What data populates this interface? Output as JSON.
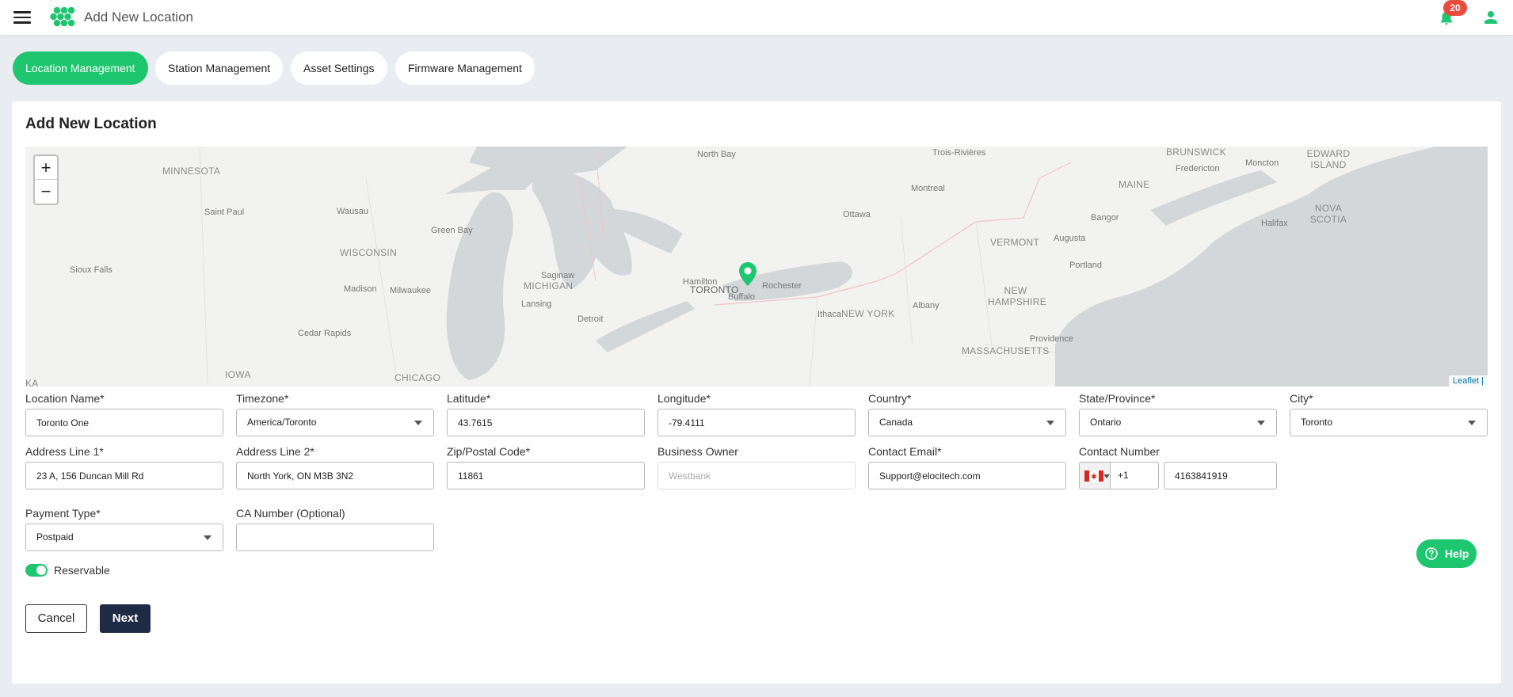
{
  "header": {
    "title": "Add New Location",
    "notification_count": "20"
  },
  "tabs": [
    {
      "label": "Location Management",
      "active": true
    },
    {
      "label": "Station Management",
      "active": false
    },
    {
      "label": "Asset Settings",
      "active": false
    },
    {
      "label": "Firmware Management",
      "active": false
    }
  ],
  "panel": {
    "title": "Add New Location"
  },
  "map": {
    "zoom_in": "+",
    "zoom_out": "−",
    "attribution": "Leaflet |",
    "labels": {
      "minnesota": "MINNESOTA",
      "wisconsin": "WISCONSIN",
      "michigan": "MICHIGAN",
      "iowa": "IOWA",
      "chicago": "CHICAGO",
      "toronto": "TORONTO",
      "new_york": "NEW YORK",
      "vermont": "VERMONT",
      "new_hampshire": "NEW HAMPSHIRE",
      "massachusetts": "MASSACHUSETTS",
      "maine": "MAINE",
      "brunswick": "BRUNSWICK",
      "edward_island": "EDWARD ISLAND",
      "nova_scotia": "NOVA SCOTIA",
      "ka": "KA",
      "saint_paul": "Saint Paul",
      "sioux_falls": "Sioux Falls",
      "madison": "Madison",
      "milwaukee": "Milwaukee",
      "cedar_rapids": "Cedar Rapids",
      "wausau": "Wausau",
      "green_bay": "Green Bay",
      "saginaw": "Saginaw",
      "lansing": "Lansing",
      "detroit": "Detroit",
      "hamilton": "Hamilton",
      "buffalo": "Buffalo",
      "rochester": "Rochester",
      "ithaca": "Ithaca",
      "albany": "Albany",
      "north_bay": "North Bay",
      "ottawa": "Ottawa",
      "montreal": "Montreal",
      "trois_rivieres": "Trois-Rivières",
      "fredericton": "Fredericton",
      "moncton": "Moncton",
      "bangor": "Bangor",
      "augusta": "Augusta",
      "portland": "Portland",
      "halifax": "Halifax",
      "providence": "Providence"
    }
  },
  "form": {
    "location_name": {
      "label": "Location Name*",
      "value": "Toronto One"
    },
    "timezone": {
      "label": "Timezone*",
      "value": "America/Toronto"
    },
    "latitude": {
      "label": "Latitude*",
      "value": "43.7615"
    },
    "longitude": {
      "label": "Longitude*",
      "value": "-79.4111"
    },
    "country": {
      "label": "Country*",
      "value": "Canada"
    },
    "state": {
      "label": "State/Province*",
      "value": "Ontario"
    },
    "city": {
      "label": "City*",
      "value": "Toronto"
    },
    "address1": {
      "label": "Address Line 1*",
      "value": "23 A, 156 Duncan Mill Rd"
    },
    "address2": {
      "label": "Address Line 2*",
      "value": "North York, ON M3B 3N2"
    },
    "zip": {
      "label": "Zip/Postal Code*",
      "value": "11861"
    },
    "business_owner": {
      "label": "Business Owner",
      "placeholder": "Westbank"
    },
    "contact_email": {
      "label": "Contact Email*",
      "value": "Support@elocitech.com"
    },
    "contact_number": {
      "label": "Contact Number",
      "dial_code": "+1",
      "value": "4163841919"
    },
    "payment_type": {
      "label": "Payment Type*",
      "value": "Postpaid"
    },
    "ca_number": {
      "label": "CA Number (Optional)",
      "value": ""
    },
    "reservable": {
      "label": "Reservable",
      "on": true
    }
  },
  "actions": {
    "cancel": "Cancel",
    "next": "Next",
    "help": "Help"
  },
  "colors": {
    "accent": "#1ec66f",
    "dark_button": "#1f2a44",
    "badge": "#e74c3c"
  }
}
